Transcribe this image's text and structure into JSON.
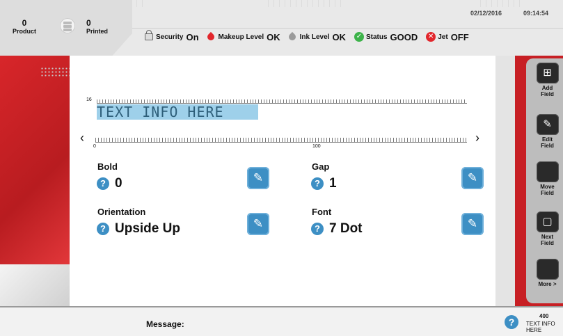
{
  "header": {
    "counters": {
      "product_value": "0",
      "product_label": "Product",
      "printed_value": "0",
      "printed_label": "Printed"
    },
    "date": "02/12/2016",
    "time": "09:14:54",
    "status": {
      "security_label": "Security",
      "security_value": "On",
      "makeup_label": "Makeup Level",
      "makeup_value": "OK",
      "ink_label": "Ink Level",
      "ink_value": "OK",
      "status_label": "Status",
      "status_value": "GOOD",
      "jet_label": "Jet",
      "jet_value": "OFF"
    }
  },
  "editor": {
    "ruler_top_tick": "16",
    "ruler_bottom_tick_start": "0",
    "ruler_bottom_tick_mid": "100",
    "field_text": "TEXT INFO HERE",
    "arrow_left": "‹",
    "arrow_right": "›",
    "properties": {
      "bold_label": "Bold",
      "bold_value": "0",
      "gap_label": "Gap",
      "gap_value": "1",
      "orientation_label": "Orientation",
      "orientation_value": "Upside Up",
      "font_label": "Font",
      "font_value": "7 Dot"
    }
  },
  "sidebar": {
    "buttons": [
      {
        "label_1": "Add",
        "label_2": "Field"
      },
      {
        "label_1": "Edit",
        "label_2": "Field"
      },
      {
        "label_1": "Move",
        "label_2": "Field"
      },
      {
        "label_1": "Next",
        "label_2": "Field"
      },
      {
        "label_1": "More >",
        "label_2": ""
      }
    ]
  },
  "footer": {
    "message_label": "Message:",
    "count": "400",
    "cut_text": "TEXT INFO HERE"
  },
  "colors": {
    "accent_red": "#c71f24",
    "accent_blue": "#3d8fc4",
    "status_green": "#3db34a",
    "field_highlight": "#9ed0ea"
  },
  "icons": {
    "security": "lock-icon",
    "makeup": "red-drop-icon",
    "ink": "gray-drop-icon",
    "status": "green-check-icon",
    "jet": "red-x-icon",
    "help": "question-icon",
    "edit": "pencil-icon"
  }
}
